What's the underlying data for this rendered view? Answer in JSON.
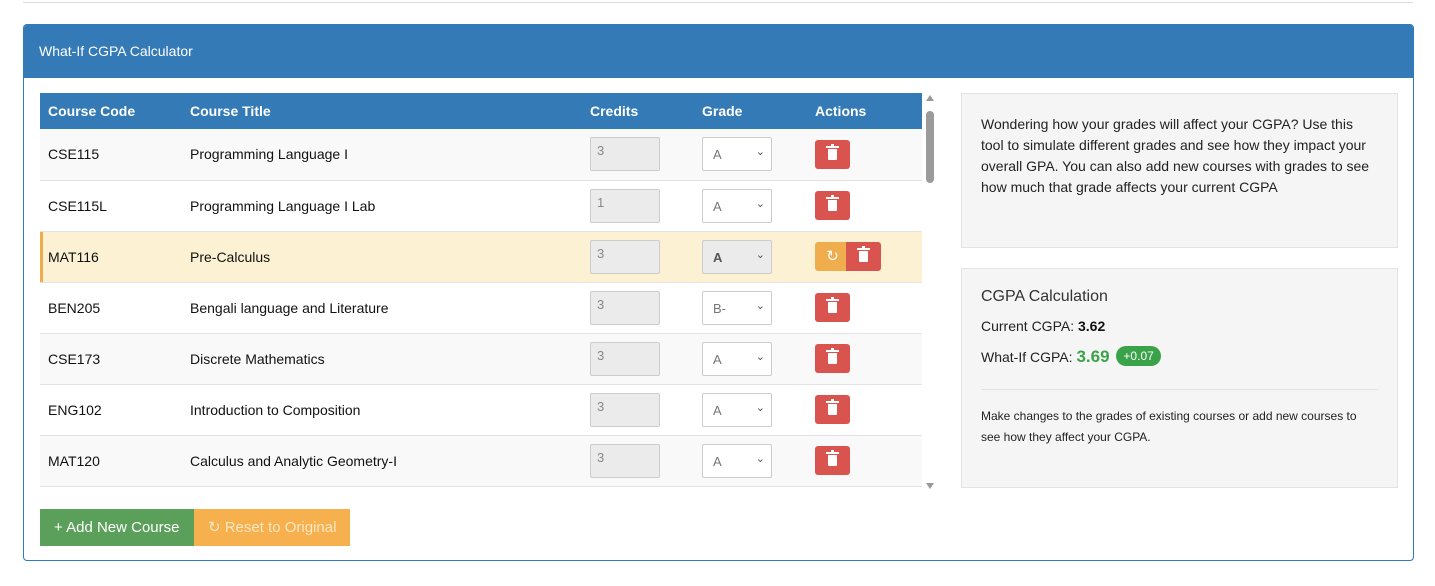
{
  "panel": {
    "title": "What-If CGPA Calculator"
  },
  "table": {
    "headers": {
      "code": "Course Code",
      "title": "Course Title",
      "credits": "Credits",
      "grade": "Grade",
      "actions": "Actions"
    },
    "rows": [
      {
        "code": "CSE115",
        "title": "Programming Language I",
        "credits": "3",
        "grade": "A"
      },
      {
        "code": "CSE115L",
        "title": "Programming Language I Lab",
        "credits": "1",
        "grade": "A"
      },
      {
        "code": "MAT116",
        "title": "Pre-Calculus",
        "credits": "3",
        "grade": "A"
      },
      {
        "code": "BEN205",
        "title": "Bengali language and Literature",
        "credits": "3",
        "grade": "B-"
      },
      {
        "code": "CSE173",
        "title": "Discrete Mathematics",
        "credits": "3",
        "grade": "A"
      },
      {
        "code": "ENG102",
        "title": "Introduction to Composition",
        "credits": "3",
        "grade": "A"
      },
      {
        "code": "MAT120",
        "title": "Calculus and Analytic Geometry-I",
        "credits": "3",
        "grade": "A"
      }
    ]
  },
  "buttons": {
    "add": "+ Add New Course",
    "reset": "↻ Reset to Original"
  },
  "info": {
    "text": "Wondering how your grades will affect your CGPA? Use this tool to simulate different grades and see how they impact your overall GPA. You can also add new courses with grades to see how much that grade affects your current CGPA"
  },
  "calc": {
    "title": "CGPA Calculation",
    "current_label": "Current CGPA:",
    "current_value": "3.62",
    "whatif_label": "What-If CGPA:",
    "whatif_value": "3.69",
    "delta": "+0.07",
    "note": "Make changes to the grades of existing courses or add new courses to see how they affect your CGPA."
  },
  "colors": {
    "primary": "#337ab7",
    "danger": "#d9534f",
    "warning": "#f0ad4e",
    "success": "#3aa349"
  }
}
